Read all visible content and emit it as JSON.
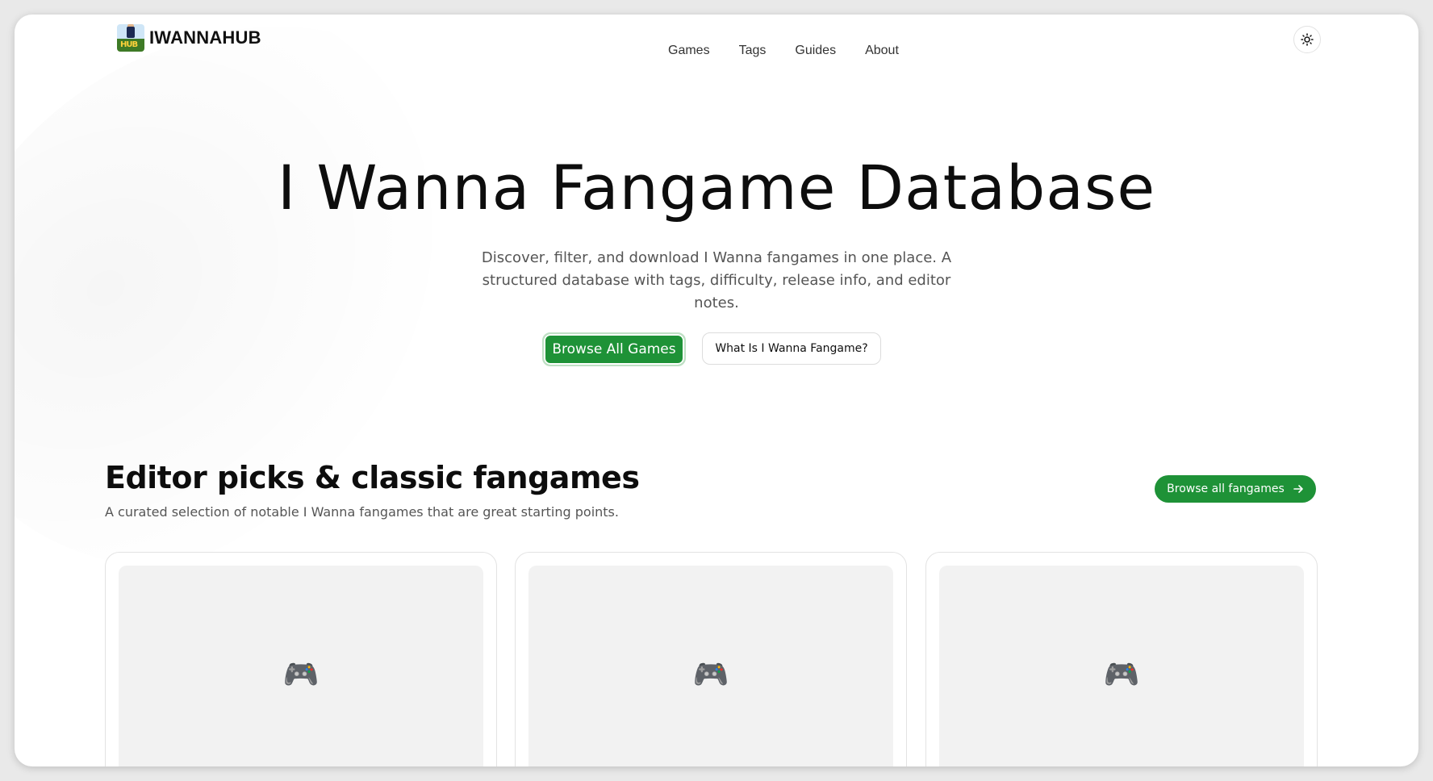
{
  "brand": {
    "name": "IWANNAHUB",
    "logo_text": "HUB"
  },
  "nav": {
    "items": [
      {
        "label": "Games"
      },
      {
        "label": "Tags"
      },
      {
        "label": "Guides"
      },
      {
        "label": "About"
      }
    ]
  },
  "theme_toggle": {
    "icon": "sun-icon"
  },
  "hero": {
    "title": "I Wanna Fangame Database",
    "subtitle": "Discover, filter, and download I Wanna fangames in one place. A structured database with tags, difficulty, release info, and editor notes.",
    "primary_button": "Browse All Games",
    "secondary_button": "What Is I Wanna Fangame?"
  },
  "section": {
    "title": "Editor picks & classic fangames",
    "subtitle": "A curated selection of notable I Wanna fangames that are great starting points.",
    "browse_button": "Browse all fangames"
  },
  "cards": [
    {
      "placeholder": "🎮"
    },
    {
      "placeholder": "🎮"
    },
    {
      "placeholder": "🎮"
    }
  ],
  "colors": {
    "accent": "#1e9237",
    "background": "#ffffff",
    "card_placeholder": "#f2f2f2"
  }
}
